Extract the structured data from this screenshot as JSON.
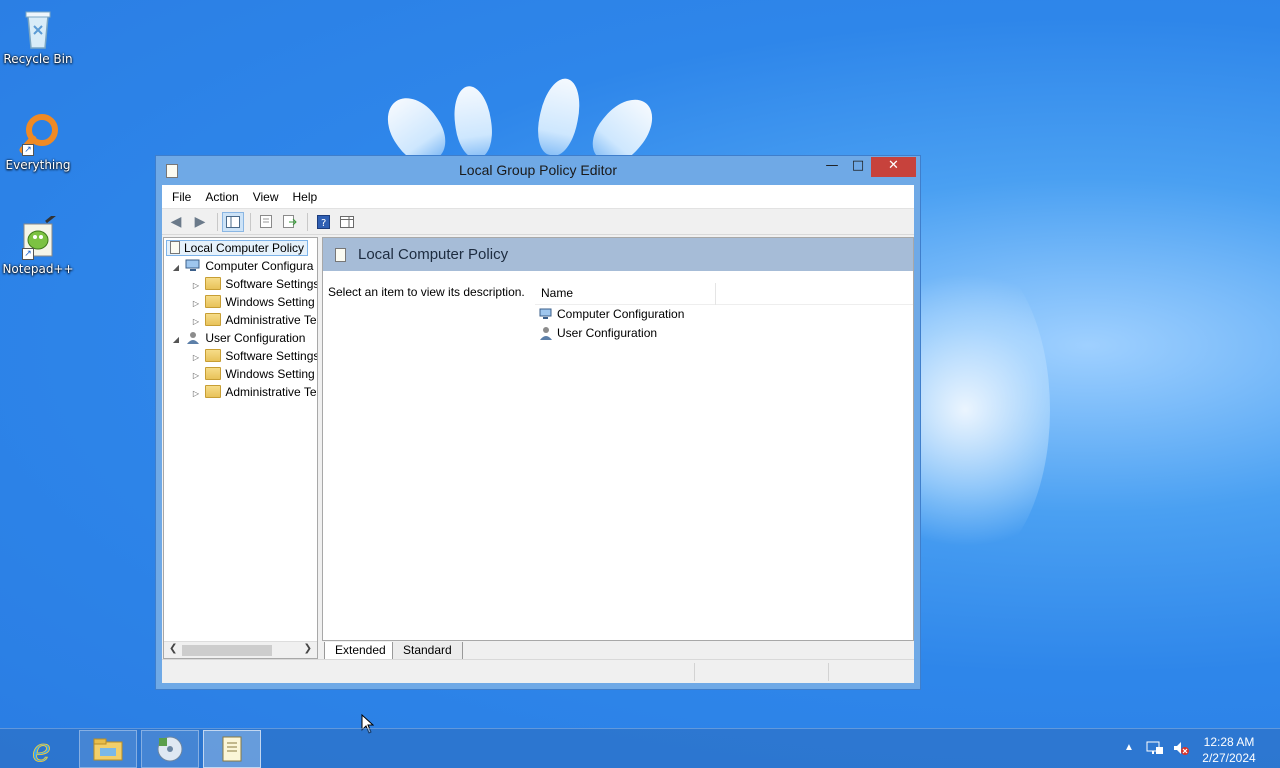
{
  "desktop": {
    "icons": [
      {
        "label": "Recycle Bin"
      },
      {
        "label": "Everything"
      },
      {
        "label": "Notepad++"
      }
    ]
  },
  "window": {
    "title": "Local Group Policy Editor",
    "menu": [
      "File",
      "Action",
      "View",
      "Help"
    ],
    "tree": {
      "root": "Local Computer Policy",
      "computer_config": "Computer Configura",
      "computer_children": [
        "Software Settings",
        "Windows Setting",
        "Administrative Te"
      ],
      "user_config": "User Configuration",
      "user_children": [
        "Software Settings",
        "Windows Setting",
        "Administrative Te"
      ]
    },
    "right_pane": {
      "header": "Local Computer Policy",
      "description": "Select an item to view its description.",
      "column_name": "Name",
      "items": [
        "Computer Configuration",
        "User Configuration"
      ]
    },
    "tabs": [
      "Extended",
      "Standard"
    ]
  },
  "taskbar": {
    "time": "12:28 AM",
    "date": "2/27/2024"
  },
  "colors": {
    "close_button": "#c7423c",
    "header_band": "#a6bcd7",
    "window_frame": "#6fa9e6"
  }
}
